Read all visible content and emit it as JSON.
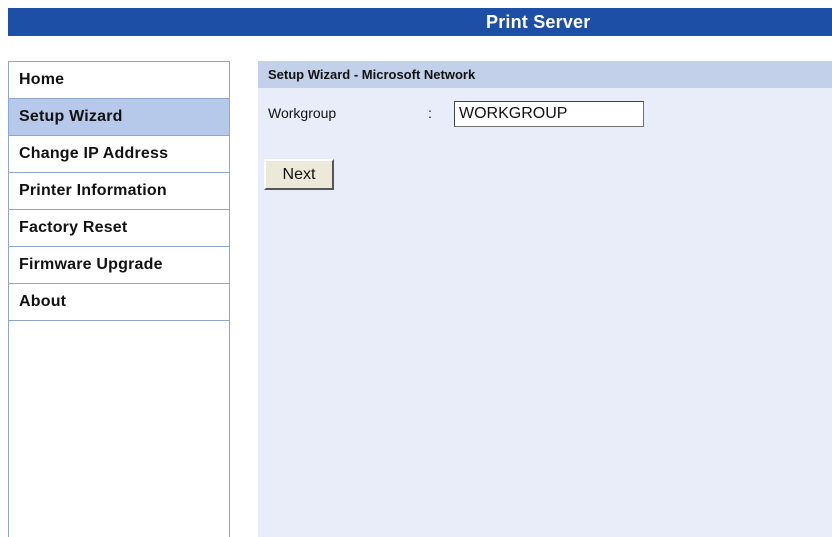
{
  "header": {
    "title": "Print Server"
  },
  "sidebar": {
    "items": [
      {
        "label": "Home",
        "active": false
      },
      {
        "label": "Setup Wizard",
        "active": true
      },
      {
        "label": "Change IP Address",
        "active": false
      },
      {
        "label": "Printer Information",
        "active": false
      },
      {
        "label": "Factory Reset",
        "active": false
      },
      {
        "label": "Firmware Upgrade",
        "active": false
      },
      {
        "label": "About",
        "active": false
      }
    ]
  },
  "main": {
    "section_title": "Setup Wizard - Microsoft Network",
    "workgroup": {
      "label": "Workgroup",
      "separator": ":",
      "value": "WORKGROUP"
    },
    "next_label": "Next"
  },
  "colors": {
    "header_bg": "#1c4fa5",
    "active_nav_bg": "#b7c9ea",
    "content_bg": "#e8edf9",
    "content_header_bg": "#c2d0ea",
    "nav_border": "#8fa6cf"
  }
}
